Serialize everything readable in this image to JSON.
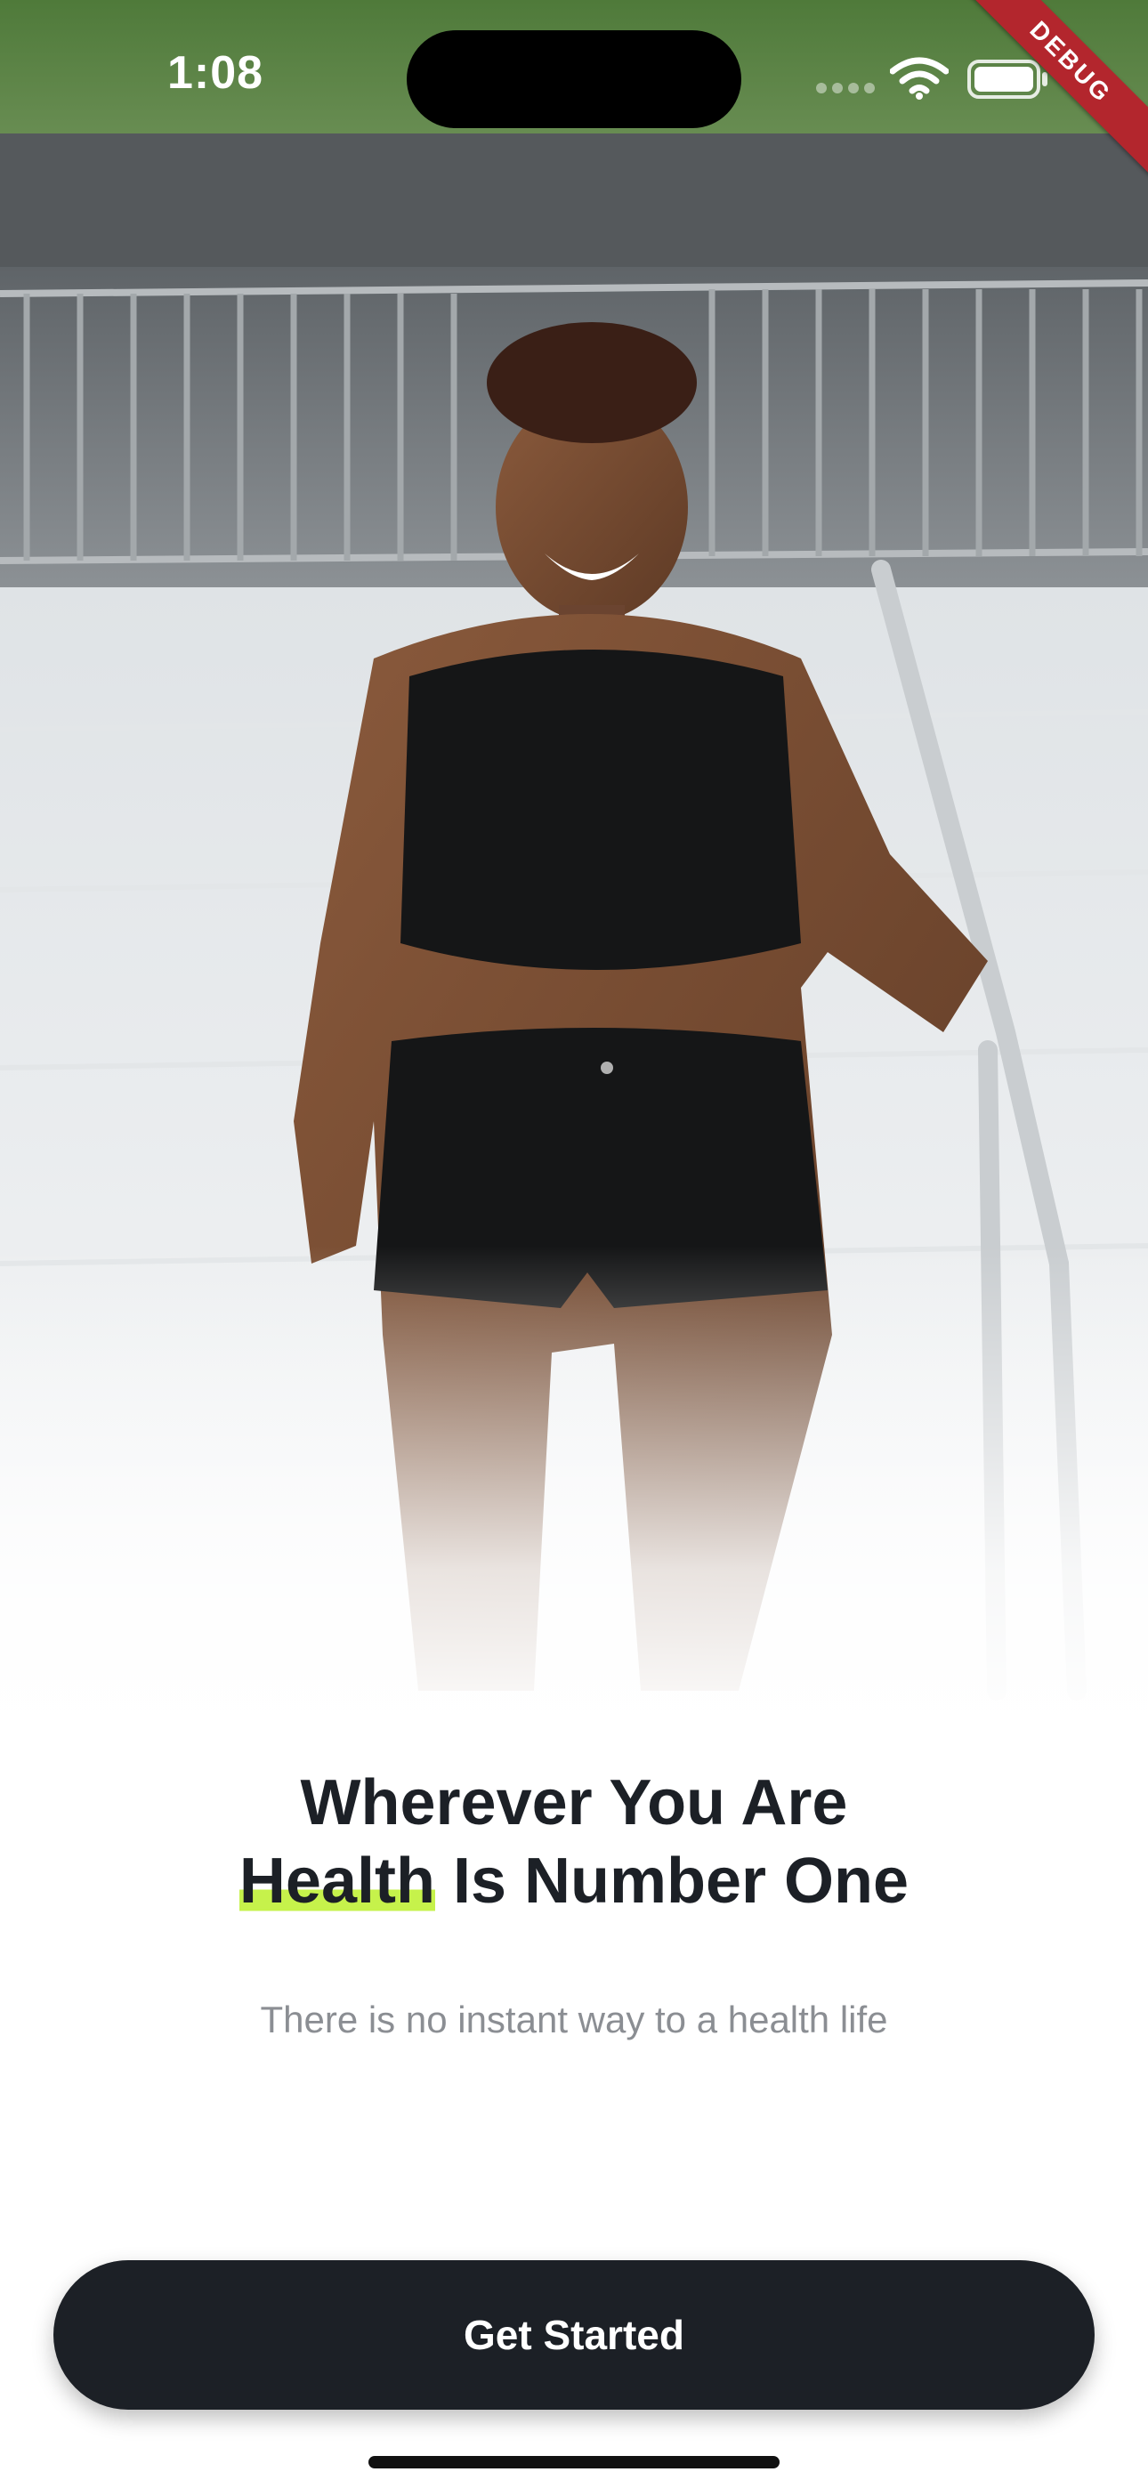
{
  "status_bar": {
    "time": "1:08"
  },
  "debug_banner": {
    "label": "DEBUG"
  },
  "onboarding": {
    "headline_line1": "Wherever You Are",
    "headline_highlight": "Health",
    "headline_line2_rest": " Is Number One",
    "subtitle": "There is no instant way to a health life",
    "cta_label": "Get Started"
  },
  "colors": {
    "highlight": "#c6f24b",
    "button_bg": "#1c2026",
    "debug_ribbon": "#b3262d"
  },
  "icons": [
    "signal-dots-icon",
    "wifi-icon",
    "battery-icon"
  ]
}
